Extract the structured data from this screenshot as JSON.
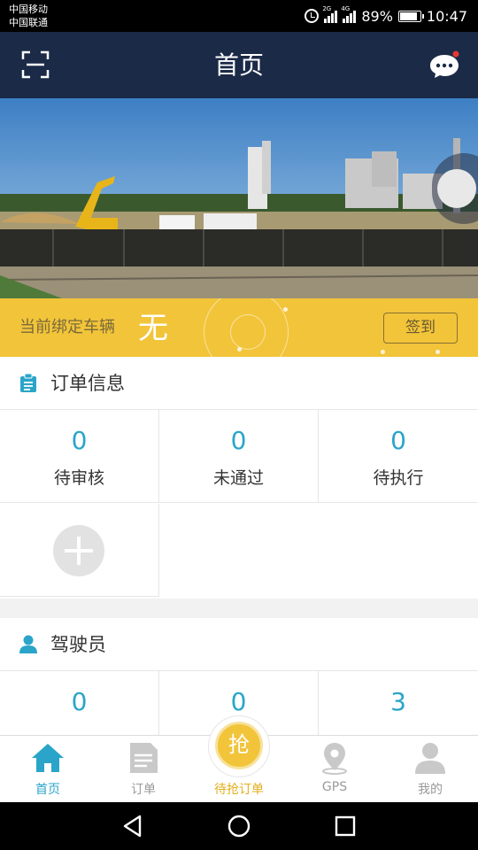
{
  "status_bar": {
    "carrier_1": "中国移动",
    "carrier_2": "中国联通",
    "network_1": "2G",
    "network_2": "4G",
    "battery": "89%",
    "battery_level": 0.89,
    "time": "10:47"
  },
  "nav": {
    "title": "首页",
    "scan_icon": "scan-icon",
    "chat_icon": "chat-icon",
    "has_notification": true
  },
  "binding": {
    "label": "当前绑定车辆",
    "value": "无",
    "sign_in_label": "签到"
  },
  "orders": {
    "title": "订单信息",
    "items": [
      {
        "count": "0",
        "label": "待审核"
      },
      {
        "count": "0",
        "label": "未通过"
      },
      {
        "count": "0",
        "label": "待执行"
      }
    ]
  },
  "driver": {
    "title": "驾驶员",
    "items": [
      {
        "count": "0"
      },
      {
        "count": "0"
      },
      {
        "count": "3"
      }
    ]
  },
  "tabbar": {
    "home": "首页",
    "orders": "订单",
    "grab": "待抢订单",
    "grab_icon_text": "抢",
    "gps": "GPS",
    "mine": "我的"
  },
  "colors": {
    "nav_bg": "#1b2a47",
    "accent": "#2aa5c9",
    "yellow": "#f2c43a"
  }
}
